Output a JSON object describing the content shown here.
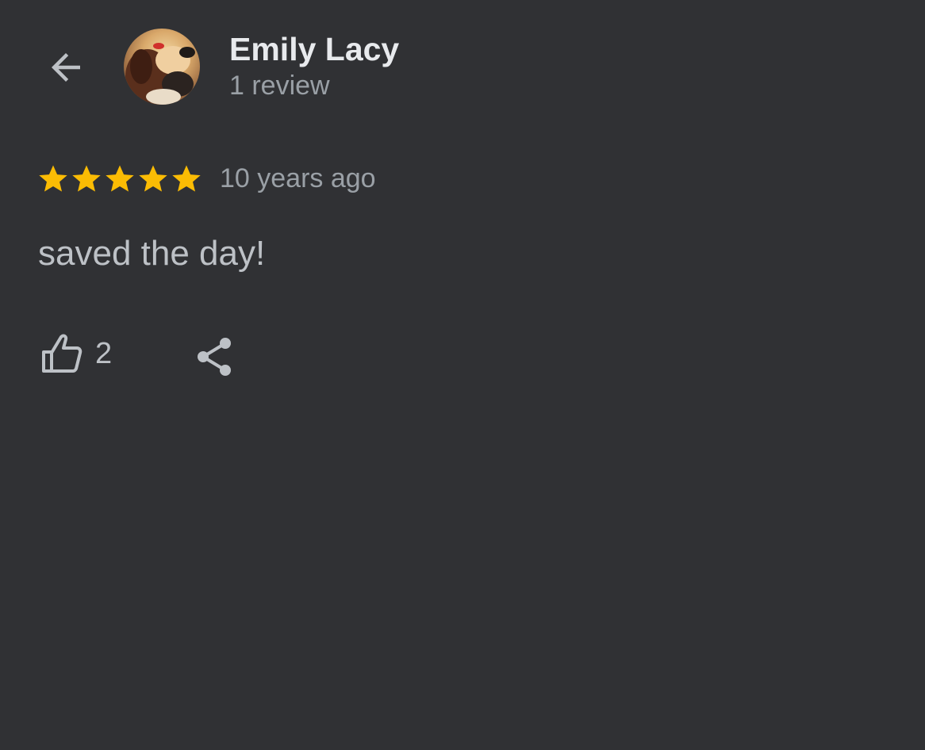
{
  "header": {
    "back_icon": "arrow-left-icon",
    "reviewer_name": "Emily Lacy",
    "review_count": "1 review",
    "avatar": "profile-photo"
  },
  "review": {
    "rating": 5,
    "rating_max": 5,
    "date": "10 years ago",
    "text": "saved the day!"
  },
  "actions": {
    "like_icon": "thumbs-up-icon",
    "like_count": "2",
    "share_icon": "share-icon"
  },
  "colors": {
    "background": "#303134",
    "star": "#fbbc04",
    "primary_text": "#e8eaed",
    "secondary_text": "#9aa0a6",
    "icon": "#bdc1c6"
  }
}
